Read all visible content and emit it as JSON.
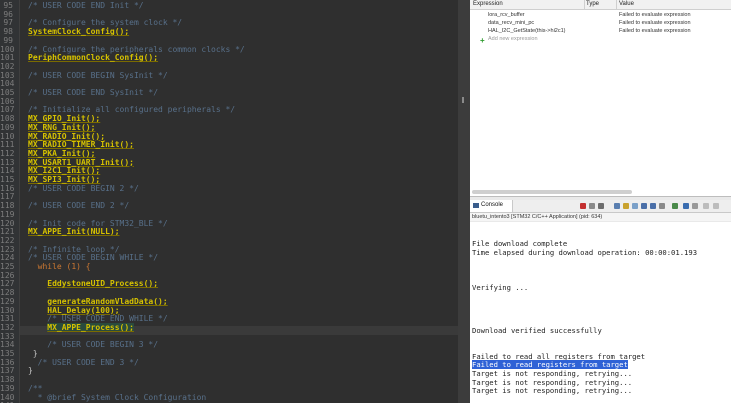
{
  "editor": {
    "line_numbers": [
      "95",
      "96",
      "97",
      "98",
      "99",
      "100",
      "101",
      "102",
      "103",
      "104",
      "105",
      "106",
      "107",
      "108",
      "109",
      "110",
      "111",
      "112",
      "113",
      "114",
      "115",
      "116",
      "117",
      "118",
      "119",
      "120",
      "121",
      "122",
      "123",
      "124",
      "125",
      "126",
      "127",
      "128",
      "129",
      "130",
      "131",
      "132",
      "133",
      "134",
      "135",
      "136",
      "137",
      "138",
      "139",
      "140",
      "141"
    ],
    "lines": [
      {
        "indent": "",
        "text": "/* USER CODE END Init */",
        "kind": "cmt"
      },
      {
        "indent": "",
        "text": "",
        "kind": "plain"
      },
      {
        "indent": "",
        "text": "/* Configure the system clock */",
        "kind": "cmt"
      },
      {
        "indent": "",
        "text": "SystemClock_Config();",
        "kind": "fn"
      },
      {
        "indent": "",
        "text": "",
        "kind": "plain"
      },
      {
        "indent": "",
        "text": "/* Configure the peripherals common clocks */",
        "kind": "cmt"
      },
      {
        "indent": "",
        "text": "PeriphCommonClock_Config();",
        "kind": "fn"
      },
      {
        "indent": "",
        "text": "",
        "kind": "plain"
      },
      {
        "indent": "",
        "text": "/* USER CODE BEGIN SysInit */",
        "kind": "cmt"
      },
      {
        "indent": "",
        "text": "",
        "kind": "plain"
      },
      {
        "indent": "",
        "text": "/* USER CODE END SysInit */",
        "kind": "cmt"
      },
      {
        "indent": "",
        "text": "",
        "kind": "plain"
      },
      {
        "indent": "",
        "text": "/* Initialize all configured peripherals */",
        "kind": "cmt"
      },
      {
        "indent": "",
        "text": "MX_GPIO_Init();",
        "kind": "fn"
      },
      {
        "indent": "",
        "text": "MX_RNG_Init();",
        "kind": "fn"
      },
      {
        "indent": "",
        "text": "MX_RADIO_Init();",
        "kind": "fn"
      },
      {
        "indent": "",
        "text": "MX_RADIO_TIMER_Init();",
        "kind": "fn"
      },
      {
        "indent": "",
        "text": "MX_PKA_Init();",
        "kind": "fn"
      },
      {
        "indent": "",
        "text": "MX_USART1_UART_Init();",
        "kind": "fn"
      },
      {
        "indent": "",
        "text": "MX_I2C1_Init();",
        "kind": "fn"
      },
      {
        "indent": "",
        "text": "MX_SPI3_Init();",
        "kind": "fn"
      },
      {
        "indent": "",
        "text": "/* USER CODE BEGIN 2 */",
        "kind": "cmt"
      },
      {
        "indent": "",
        "text": "",
        "kind": "plain"
      },
      {
        "indent": "",
        "text": "/* USER CODE END 2 */",
        "kind": "cmt"
      },
      {
        "indent": "",
        "text": "",
        "kind": "plain"
      },
      {
        "indent": "",
        "text": "/* Init code for STM32_BLE */",
        "kind": "cmt"
      },
      {
        "indent": "",
        "text": "MX_APPE_Init(NULL);",
        "kind": "fn"
      },
      {
        "indent": "",
        "text": "",
        "kind": "plain"
      },
      {
        "indent": "",
        "text": "/* Infinite loop */",
        "kind": "cmt"
      },
      {
        "indent": "",
        "text": "/* USER CODE BEGIN WHILE */",
        "kind": "cmt"
      },
      {
        "indent": "  ",
        "text": "while (1) {",
        "kind": "kw"
      },
      {
        "indent": "",
        "text": "",
        "kind": "plain"
      },
      {
        "indent": "    ",
        "text": "EddystoneUID_Process();",
        "kind": "fn"
      },
      {
        "indent": "",
        "text": "",
        "kind": "plain"
      },
      {
        "indent": "    ",
        "text": "generateRandomVladData();",
        "kind": "fn"
      },
      {
        "indent": "    ",
        "text": "HAL_Delay(100);",
        "kind": "fn"
      },
      {
        "indent": "    ",
        "text": "/* USER CODE END WHILE */",
        "kind": "cmt"
      },
      {
        "indent": "    ",
        "text": "MX_APPE_Process();",
        "kind": "fnhl"
      },
      {
        "indent": "",
        "text": "",
        "kind": "plain"
      },
      {
        "indent": "    ",
        "text": "/* USER CODE BEGIN 3 */",
        "kind": "cmt"
      },
      {
        "indent": " ",
        "text": "}",
        "kind": "plain"
      },
      {
        "indent": "  ",
        "text": "/* USER CODE END 3 */",
        "kind": "cmt"
      },
      {
        "indent": "",
        "text": "}",
        "kind": "plain"
      },
      {
        "indent": "",
        "text": "",
        "kind": "plain"
      },
      {
        "indent": "",
        "text": "/**",
        "kind": "cmt"
      },
      {
        "indent": "  ",
        "text": "* @brief System Clock Configuration",
        "kind": "cmt"
      }
    ]
  },
  "expressions": {
    "headers": {
      "expression": "Expression",
      "type": "Type",
      "value": "Value"
    },
    "rows": [
      {
        "name": "lora_rcv_buffer",
        "type": "",
        "value": "Failed to evaluate expression"
      },
      {
        "name": "data_recv_mini_pc",
        "type": "",
        "value": "Failed to evaluate expression"
      },
      {
        "name": "HAL_I2C_GetState(this->hi2c1)",
        "type": "",
        "value": "Failed to evaluate expression"
      }
    ],
    "add_label": "Add new expression"
  },
  "console": {
    "tab_label": "Console",
    "subtitle": "bluetu_intento3 [STM32 C/C++ Application] (pid: 634)",
    "lines": [
      {
        "text": "File download complete",
        "row": 2,
        "selected": false
      },
      {
        "text": "Time elapsed during download operation: 00:00:01.193",
        "row": 3,
        "selected": false
      },
      {
        "text": "Verifying ...",
        "row": 7,
        "selected": false
      },
      {
        "text": "Download verified successfully",
        "row": 12,
        "selected": false
      },
      {
        "text": "Failed to read all registers from target",
        "row": 15,
        "selected": false
      },
      {
        "text": "Failed to read registers from target",
        "row": 16,
        "selected": true
      },
      {
        "text": "Target is not responding, retrying...",
        "row": 17,
        "selected": false
      },
      {
        "text": "Target is not responding, retrying...",
        "row": 18,
        "selected": false
      },
      {
        "text": "Target is not responding, retrying...",
        "row": 19,
        "selected": false
      }
    ]
  }
}
